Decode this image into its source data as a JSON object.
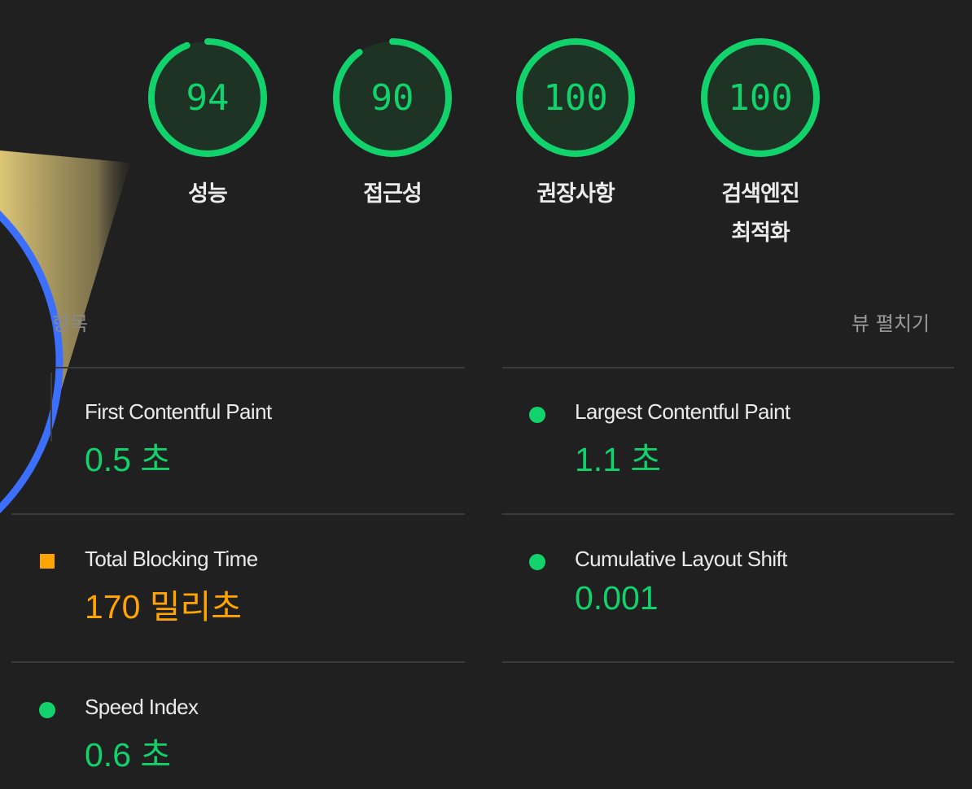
{
  "gauges": [
    {
      "score": "94",
      "label": "성능",
      "value": 94,
      "color": "#12d26b"
    },
    {
      "score": "90",
      "label": "접근성",
      "value": 90,
      "color": "#12d26b"
    },
    {
      "score": "100",
      "label": "권장사항",
      "value": 100,
      "color": "#12d26b"
    },
    {
      "score": "100",
      "label": "검색엔진\n최적화",
      "value": 100,
      "color": "#12d26b"
    }
  ],
  "metrics_header": {
    "label": "항목",
    "expand_label": "뷰 펼치기"
  },
  "metrics": [
    {
      "name": "First Contentful Paint",
      "value": "0.5 초",
      "status": "pass",
      "indicator": "none"
    },
    {
      "name": "Largest Contentful Paint",
      "value": "1.1 초",
      "status": "pass",
      "indicator": "green-circle"
    },
    {
      "name": "Total Blocking Time",
      "value": "170 밀리초",
      "status": "average",
      "indicator": "orange-square"
    },
    {
      "name": "Cumulative Layout Shift",
      "value": "0.001",
      "status": "pass",
      "indicator": "green-circle"
    },
    {
      "name": "Speed Index",
      "value": "0.6 초",
      "status": "pass",
      "indicator": "green-circle"
    }
  ],
  "colors": {
    "background": "#202020",
    "pass": "#12d26b",
    "average": "#ffa400",
    "magnifier_ring": "#3d6fff",
    "highlight": "#e6cf7a"
  }
}
